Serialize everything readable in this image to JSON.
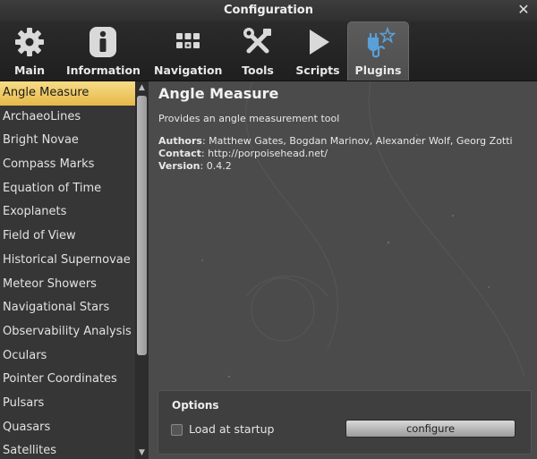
{
  "window": {
    "title": "Configuration"
  },
  "tabs": [
    {
      "label": "Main",
      "icon": "gear-icon"
    },
    {
      "label": "Information",
      "icon": "info-icon"
    },
    {
      "label": "Navigation",
      "icon": "keyboard-icon"
    },
    {
      "label": "Tools",
      "icon": "tools-icon"
    },
    {
      "label": "Scripts",
      "icon": "play-icon"
    },
    {
      "label": "Plugins",
      "icon": "plug-star-icon",
      "active": true
    }
  ],
  "plugins": {
    "selected_index": 0,
    "items": [
      "Angle Measure",
      "ArchaeoLines",
      "Bright Novae",
      "Compass Marks",
      "Equation of Time",
      "Exoplanets",
      "Field of View",
      "Historical Supernovae",
      "Meteor Showers",
      "Navigational Stars",
      "Observability Analysis",
      "Oculars",
      "Pointer Coordinates",
      "Pulsars",
      "Quasars",
      "Satellites"
    ]
  },
  "details": {
    "name": "Angle Measure",
    "description": "Provides an angle measurement tool",
    "authors_label": "Authors",
    "authors": ": Matthew Gates, Bogdan Marinov, Alexander Wolf, Georg Zotti",
    "contact_label": "Contact",
    "contact": ": http://porpoisehead.net/",
    "version_label": "Version",
    "version": ": 0.4.2"
  },
  "options": {
    "title": "Options",
    "load_at_startup_label": "Load at startup",
    "load_at_startup_checked": false,
    "configure_label": "configure"
  },
  "colors": {
    "selection_top": "#f7dc86",
    "selection_bottom": "#e6b84a",
    "plugins_icon": "#5aa0d8"
  }
}
